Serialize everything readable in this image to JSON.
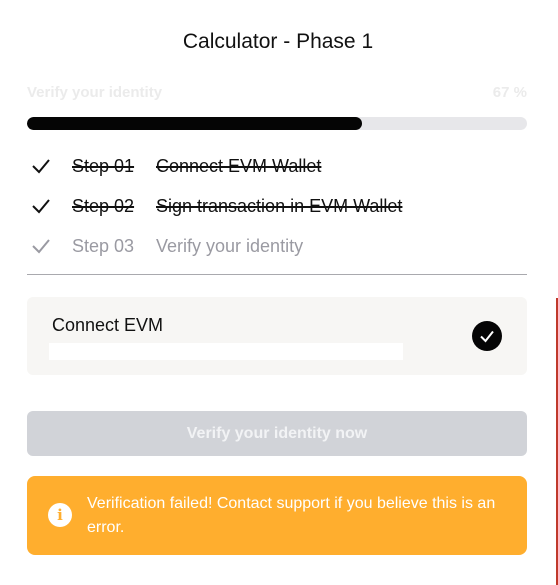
{
  "title": "Calculator - Phase 1",
  "progress": {
    "label": "Verify your identity",
    "percent_text": "67 %",
    "fraction": 0.67
  },
  "steps": [
    {
      "number": "Step 01",
      "label": "Connect EVM Wallet",
      "status": "done",
      "icon": "check-icon"
    },
    {
      "number": "Step 02",
      "label": "Sign transaction in EVM Wallet",
      "status": "done",
      "icon": "check-icon"
    },
    {
      "number": "Step 03",
      "label": "Verify your identity",
      "status": "pending",
      "icon": "check-icon"
    }
  ],
  "connect_card": {
    "title": "Connect EVM",
    "status_icon": "check-circle-icon"
  },
  "verify_button": {
    "label": "Verify your identity now",
    "state": "disabled"
  },
  "alert": {
    "icon": "info-icon",
    "message": "Verification failed! Contact support if you believe this is an error.",
    "color": "#ffae2e"
  },
  "colors": {
    "progress_fill": "#050505",
    "progress_track": "#e7e7ea",
    "button_disabled": "#d1d3d8",
    "alert_bg": "#ffae2e",
    "pending_text": "#9a9aa2"
  }
}
